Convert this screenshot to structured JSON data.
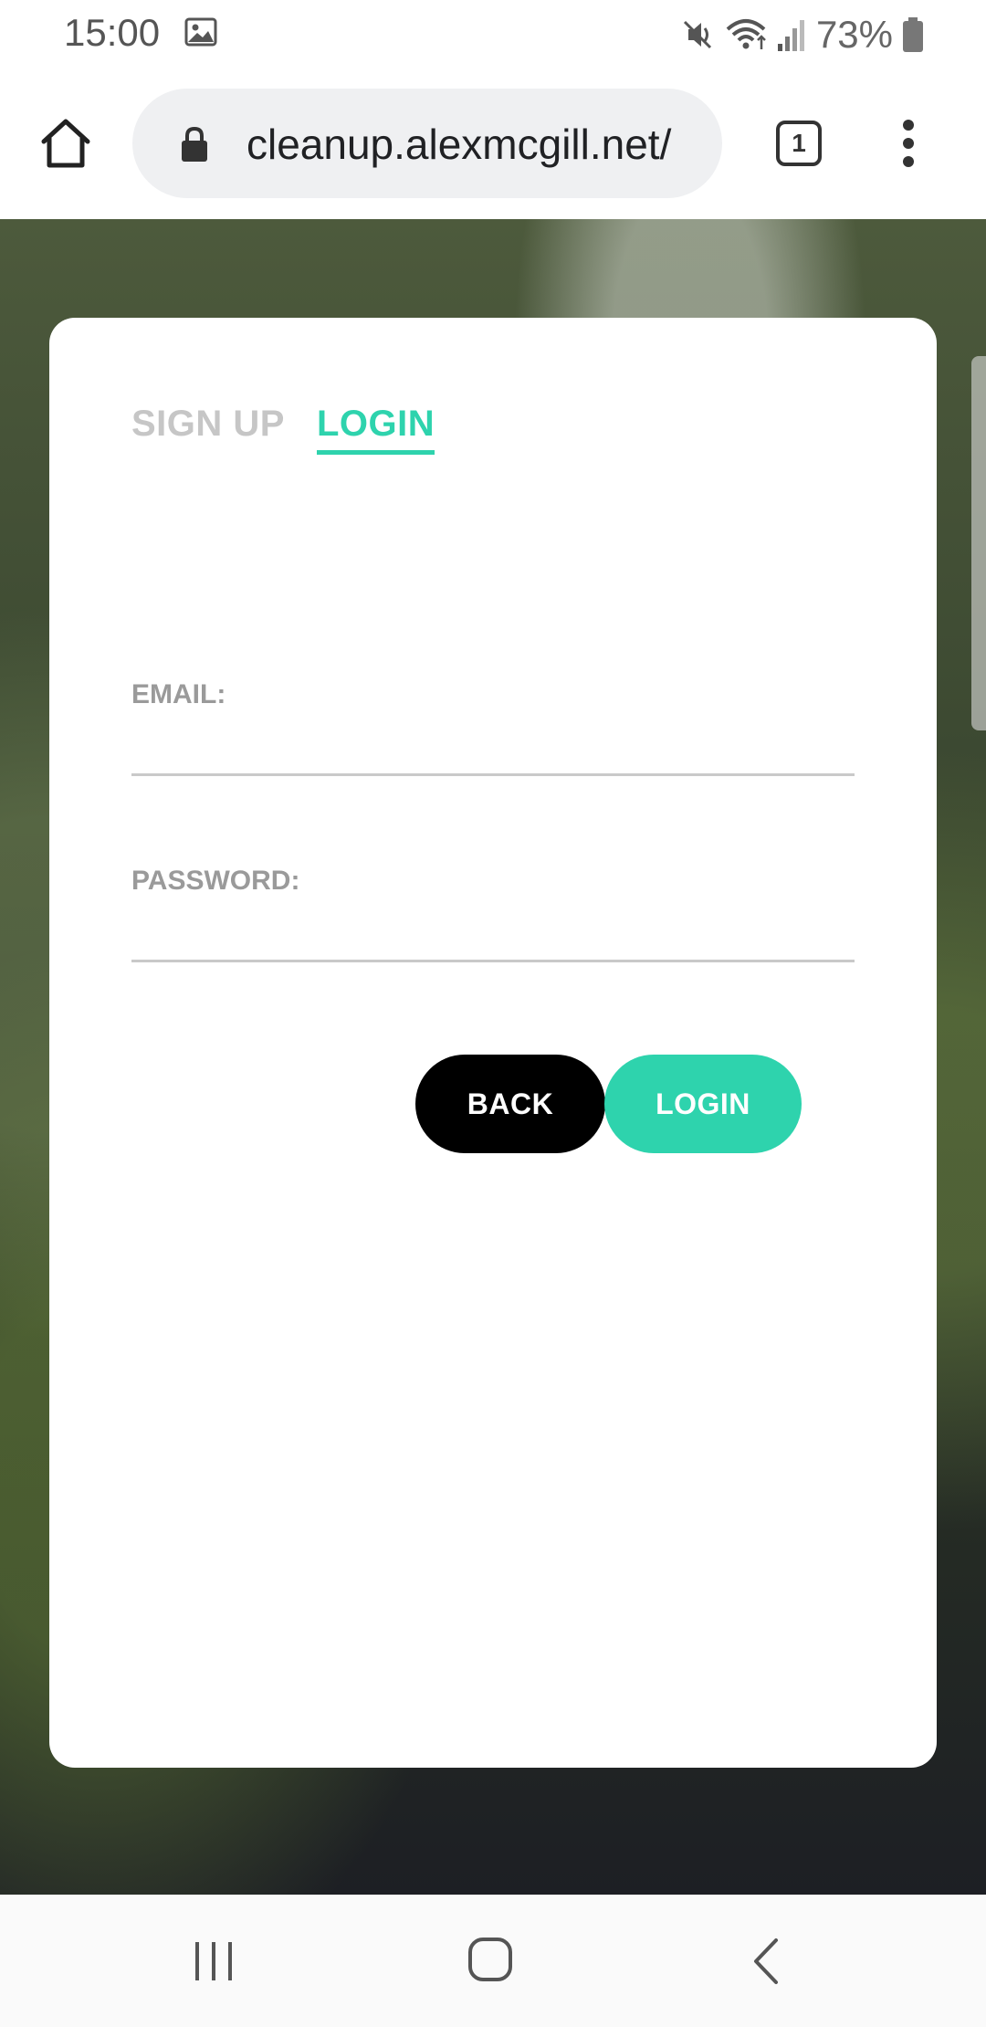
{
  "status_bar": {
    "time": "15:00",
    "battery": "73%",
    "icons": [
      "gallery-icon",
      "mute-icon",
      "wifi-icon",
      "signal-icon",
      "battery-icon"
    ]
  },
  "browser": {
    "url": "cleanup.alexmcgill.net/",
    "tab_count": "1",
    "icons": [
      "home-icon",
      "lock-icon",
      "tabs-icon",
      "more-vert-icon"
    ]
  },
  "auth_card": {
    "tabs": [
      {
        "label": "SIGN UP",
        "active": false
      },
      {
        "label": "LOGIN",
        "active": true
      }
    ],
    "email_label": "EMAIL:",
    "email_value": "",
    "password_label": "PASSWORD:",
    "password_value": "",
    "back_button": "BACK",
    "login_button": "LOGIN"
  },
  "nav_bar": {
    "icons": [
      "recent-apps-icon",
      "home-circle-icon",
      "back-icon"
    ]
  },
  "colors": {
    "accent": "#2ed3ad",
    "back_button": "#000000",
    "inactive_tab": "#c6c6c6",
    "label": "#9a9a9a"
  }
}
